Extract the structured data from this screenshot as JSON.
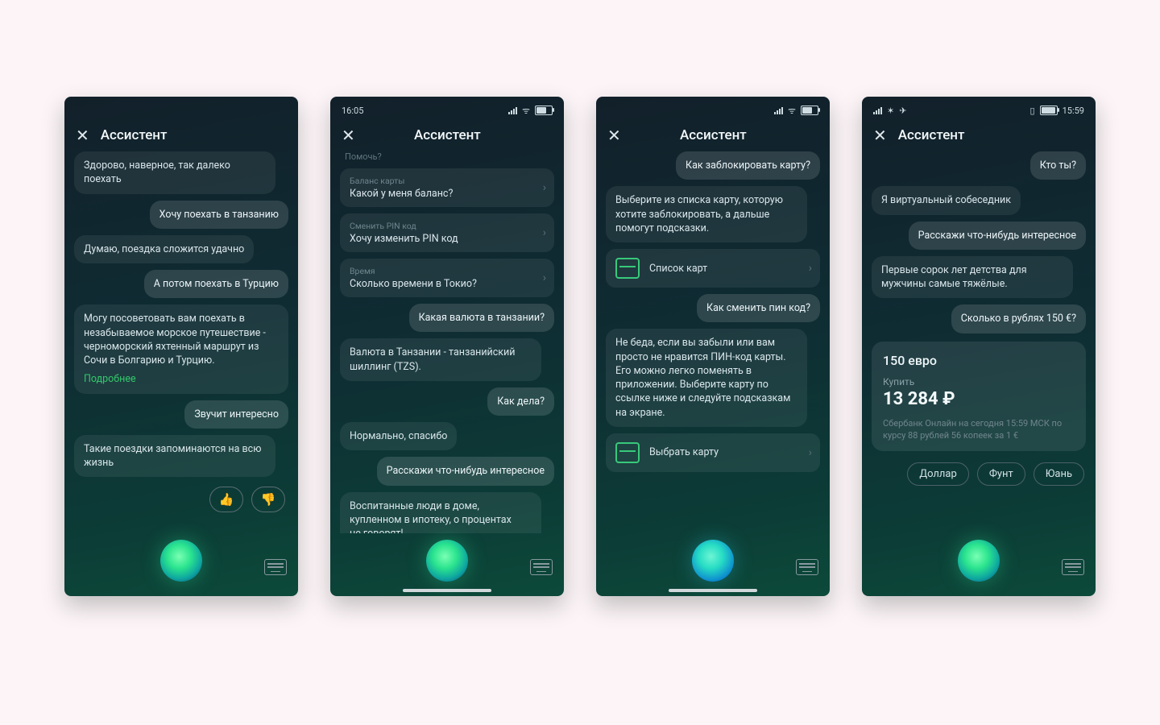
{
  "common": {
    "title": "Ассистент"
  },
  "s1": {
    "m0": "Здорово, наверное, так далеко поехать",
    "m1": "Хочу поехать в танзанию",
    "m2": "Думаю, поездка сложится удачно",
    "m3": "А потом поехать в Турцию",
    "m4": "Могу посоветовать вам поехать в незабываемое морское путешествие - черноморский яхтенный маршрут из Сочи в Болгарию и Турцию.",
    "m4_link": "Подробнее",
    "m5": "Звучит интересно",
    "m6": "Такие поездки запоминаются на всю жизнь"
  },
  "s2": {
    "time": "16:05",
    "hint": "Помочь?",
    "items": [
      {
        "sub": "Баланс карты",
        "main": "Какой у меня баланс?"
      },
      {
        "sub": "Сменить PIN код",
        "main": "Хочу изменить PIN код"
      },
      {
        "sub": "Время",
        "main": "Сколько времени в Токио?"
      }
    ],
    "u1": "Какая валюта в танзании?",
    "a1": "Валюта в Танзании - танзанийский шиллинг (TZS).",
    "u2": "Как дела?",
    "a2": "Нормально, спасибо",
    "u3": "Расскажи что-нибудь интересное",
    "a3": "Воспитанные люди в доме, купленном в ипотеку, о процентах\nне говорят!"
  },
  "s3": {
    "u1": "Как заблокировать карту?",
    "a1": "Выберите из списка карту, которую хотите заблокировать, а дальше помогут подсказки.",
    "card1": "Список карт",
    "u2": "Как сменить пин код?",
    "a2": "Не беда, если вы забыли или вам просто не нравится ПИН-код карты. Его можно легко поменять в приложении. Выберите карту по ссылке ниже и следуйте подсказкам на экране.",
    "card2": "Выбрать карту"
  },
  "s4": {
    "time": "15:59",
    "u1": "Кто ты?",
    "a1": "Я виртуальный собеседник",
    "u2": "Расскажи что-нибудь интересное",
    "a2": "Первые сорок лет детства для мужчины самые тяжёлые.",
    "u3": "Сколько в рублях 150 €?",
    "card": {
      "title": "150 евро",
      "buy": "Купить",
      "amount": "13 284 ₽",
      "fine": "Сбербанк Онлайн на сегодня 15:59 МСК по курсу 88 рублей 56 копеек за 1 €"
    },
    "chips": [
      "Доллар",
      "Фунт",
      "Юань"
    ]
  }
}
